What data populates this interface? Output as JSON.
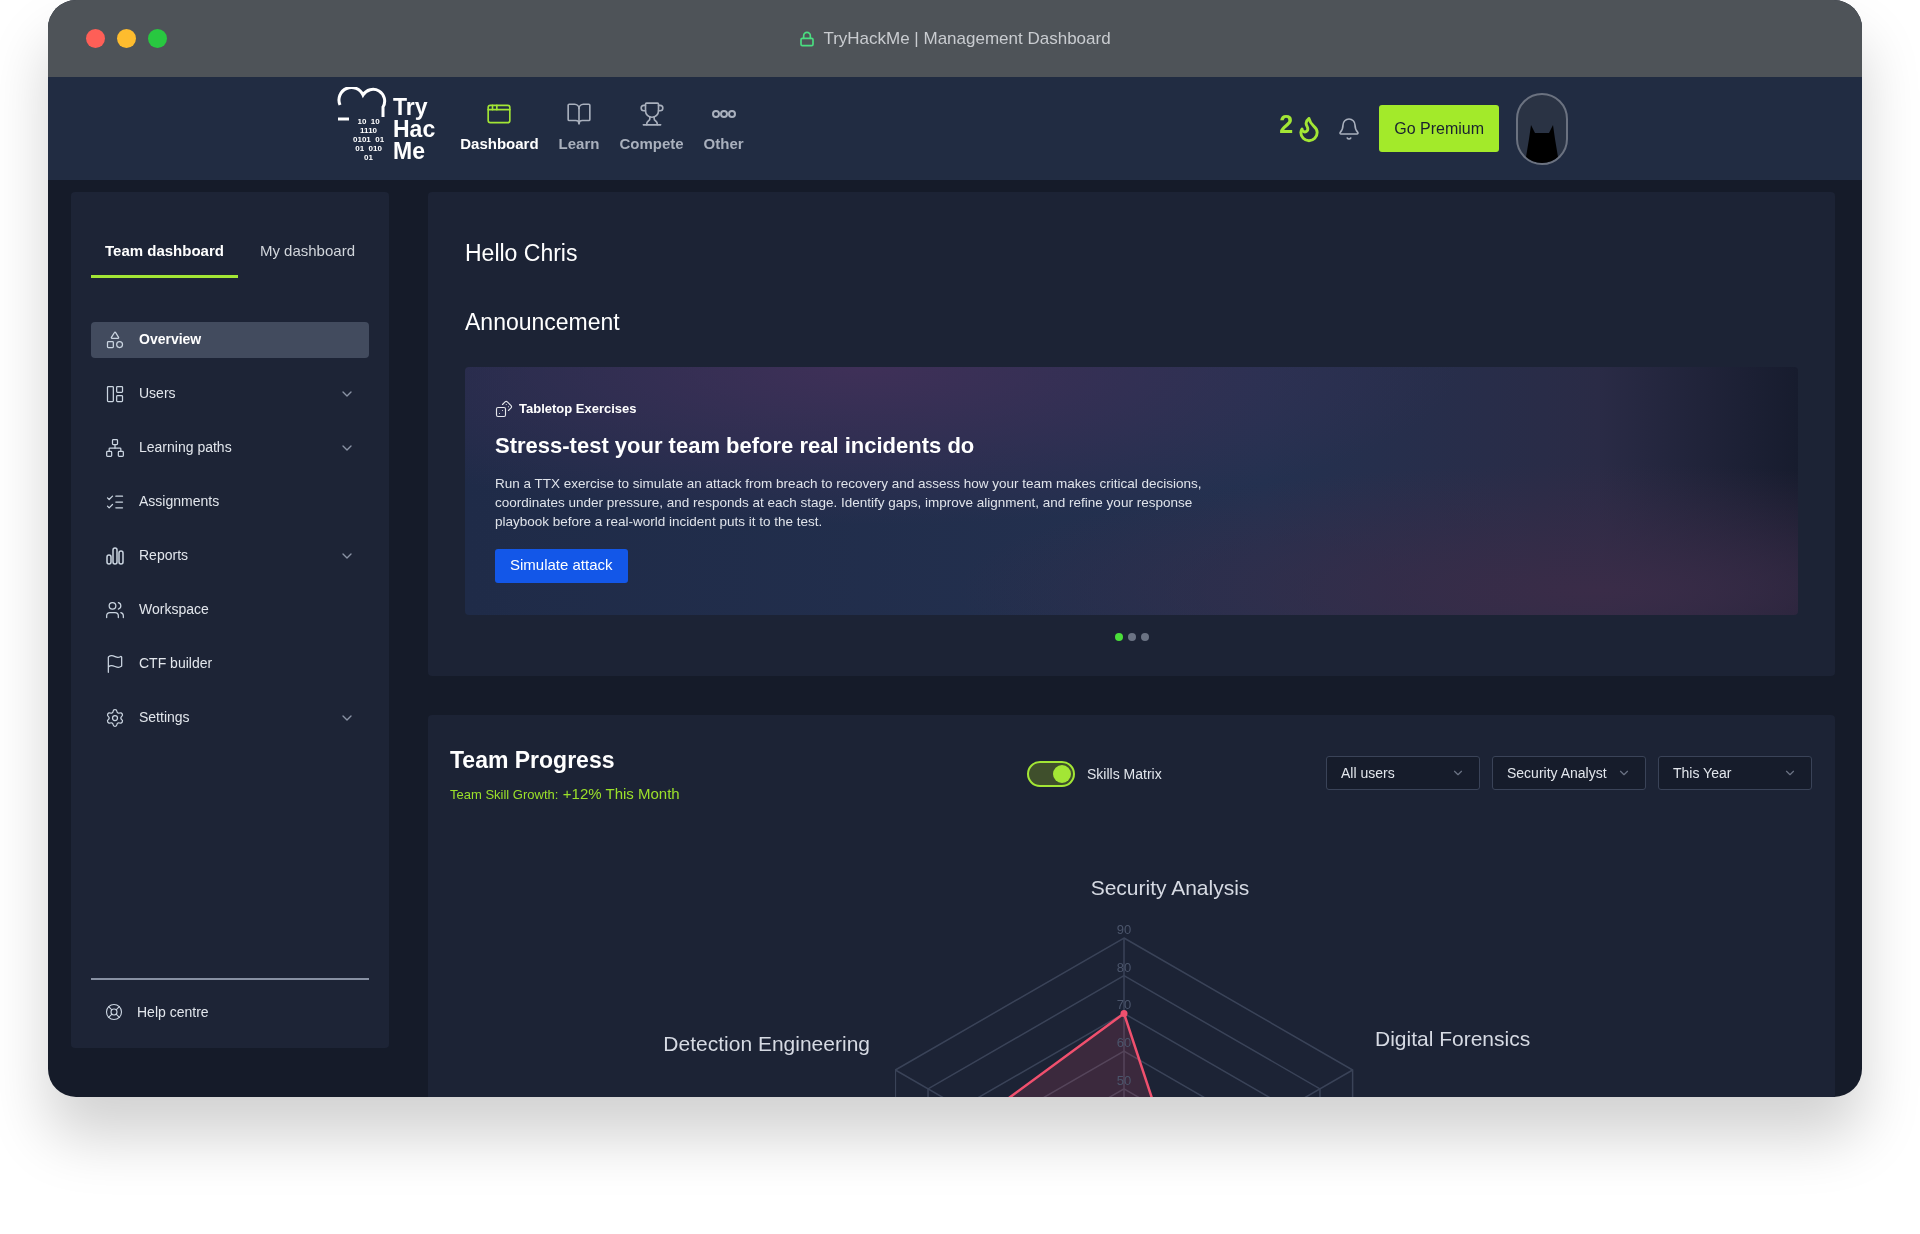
{
  "window": {
    "title": "TryHackMe | Management Dashboard"
  },
  "logo": {
    "bits": [
      "10  10",
      "1110",
      "0101  01",
      "01  010",
      "01"
    ],
    "words": [
      "Try",
      "Hac",
      "Me"
    ]
  },
  "nav": [
    {
      "label": "Dashboard",
      "selected": true
    },
    {
      "label": "Learn",
      "selected": false
    },
    {
      "label": "Compete",
      "selected": false
    },
    {
      "label": "Other",
      "selected": false
    }
  ],
  "streak": "2",
  "premium_button": "Go Premium",
  "sidebar": {
    "tabs": [
      {
        "label": "Team dashboard",
        "selected": true
      },
      {
        "label": "My dashboard",
        "selected": false
      }
    ],
    "items": [
      {
        "label": "Overview",
        "selected": true,
        "expandable": false
      },
      {
        "label": "Users",
        "selected": false,
        "expandable": true
      },
      {
        "label": "Learning paths",
        "selected": false,
        "expandable": true
      },
      {
        "label": "Assignments",
        "selected": false,
        "expandable": false
      },
      {
        "label": "Reports",
        "selected": false,
        "expandable": true
      },
      {
        "label": "Workspace",
        "selected": false,
        "expandable": false
      },
      {
        "label": "CTF builder",
        "selected": false,
        "expandable": false
      },
      {
        "label": "Settings",
        "selected": false,
        "expandable": true
      }
    ],
    "help": "Help centre"
  },
  "greeting": "Hello Chris",
  "announcement": {
    "heading": "Announcement",
    "tag": "Tabletop Exercises",
    "title": "Stress-test your team before real incidents do",
    "body": "Run a TTX exercise to simulate an attack from breach to recovery and assess how your team makes critical decisions, coordinates under pressure, and responds at each stage. Identify gaps, improve alignment, and refine your response playbook before a real-world incident puts it to the test.",
    "button": "Simulate attack",
    "dots": [
      {
        "selected": true
      },
      {
        "selected": false
      },
      {
        "selected": false
      }
    ]
  },
  "progress": {
    "title": "Team Progress",
    "growth_label": "Team Skill Growth:",
    "growth_value": "+12% This Month",
    "toggle": {
      "label": "Skills Matrix",
      "on": true
    },
    "filters": [
      "All users",
      "Security Analyst",
      "This Year"
    ],
    "skills_chart": {
      "axes": [
        "Security Analysis",
        "Detection Engineering",
        "Digital Forensics"
      ],
      "ticks": [
        "90",
        "80",
        "70",
        "60",
        "50"
      ]
    }
  }
}
